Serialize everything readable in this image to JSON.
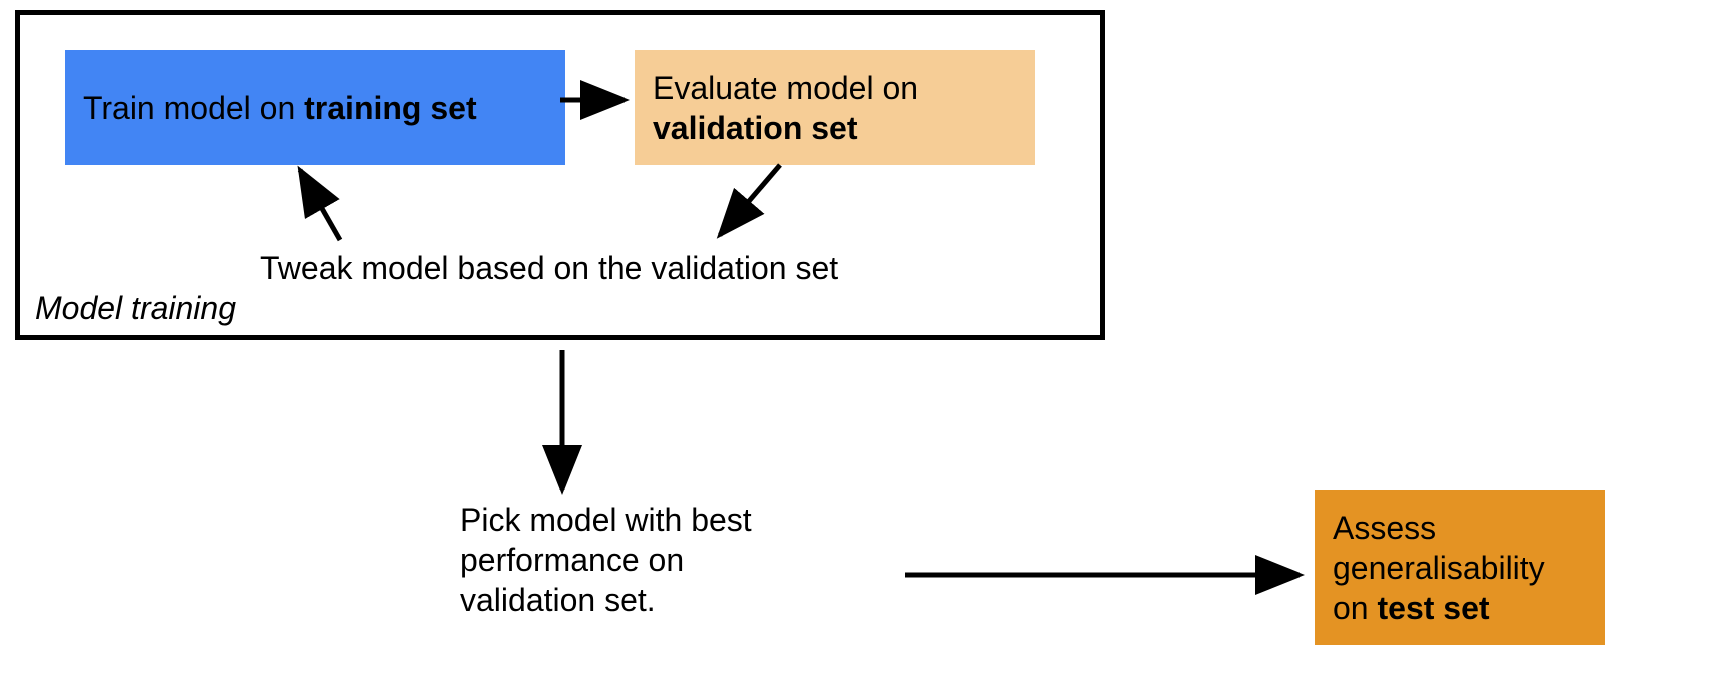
{
  "training_box_label": "Model training",
  "train": {
    "prefix": "Train model on ",
    "bold": "training set"
  },
  "validate": {
    "line1": "Evaluate model on",
    "bold": "validation set"
  },
  "tweak": "Tweak model based on the validation set",
  "pick": {
    "line1": "Pick model with best",
    "line2": "performance on",
    "line3": "validation set."
  },
  "test": {
    "line1": "Assess",
    "line2": "generalisability",
    "line3_prefix": "on ",
    "line3_bold": "test set"
  },
  "colors": {
    "train_box": "#4285f4",
    "validate_box": "#f6cd96",
    "test_box": "#e49323"
  }
}
